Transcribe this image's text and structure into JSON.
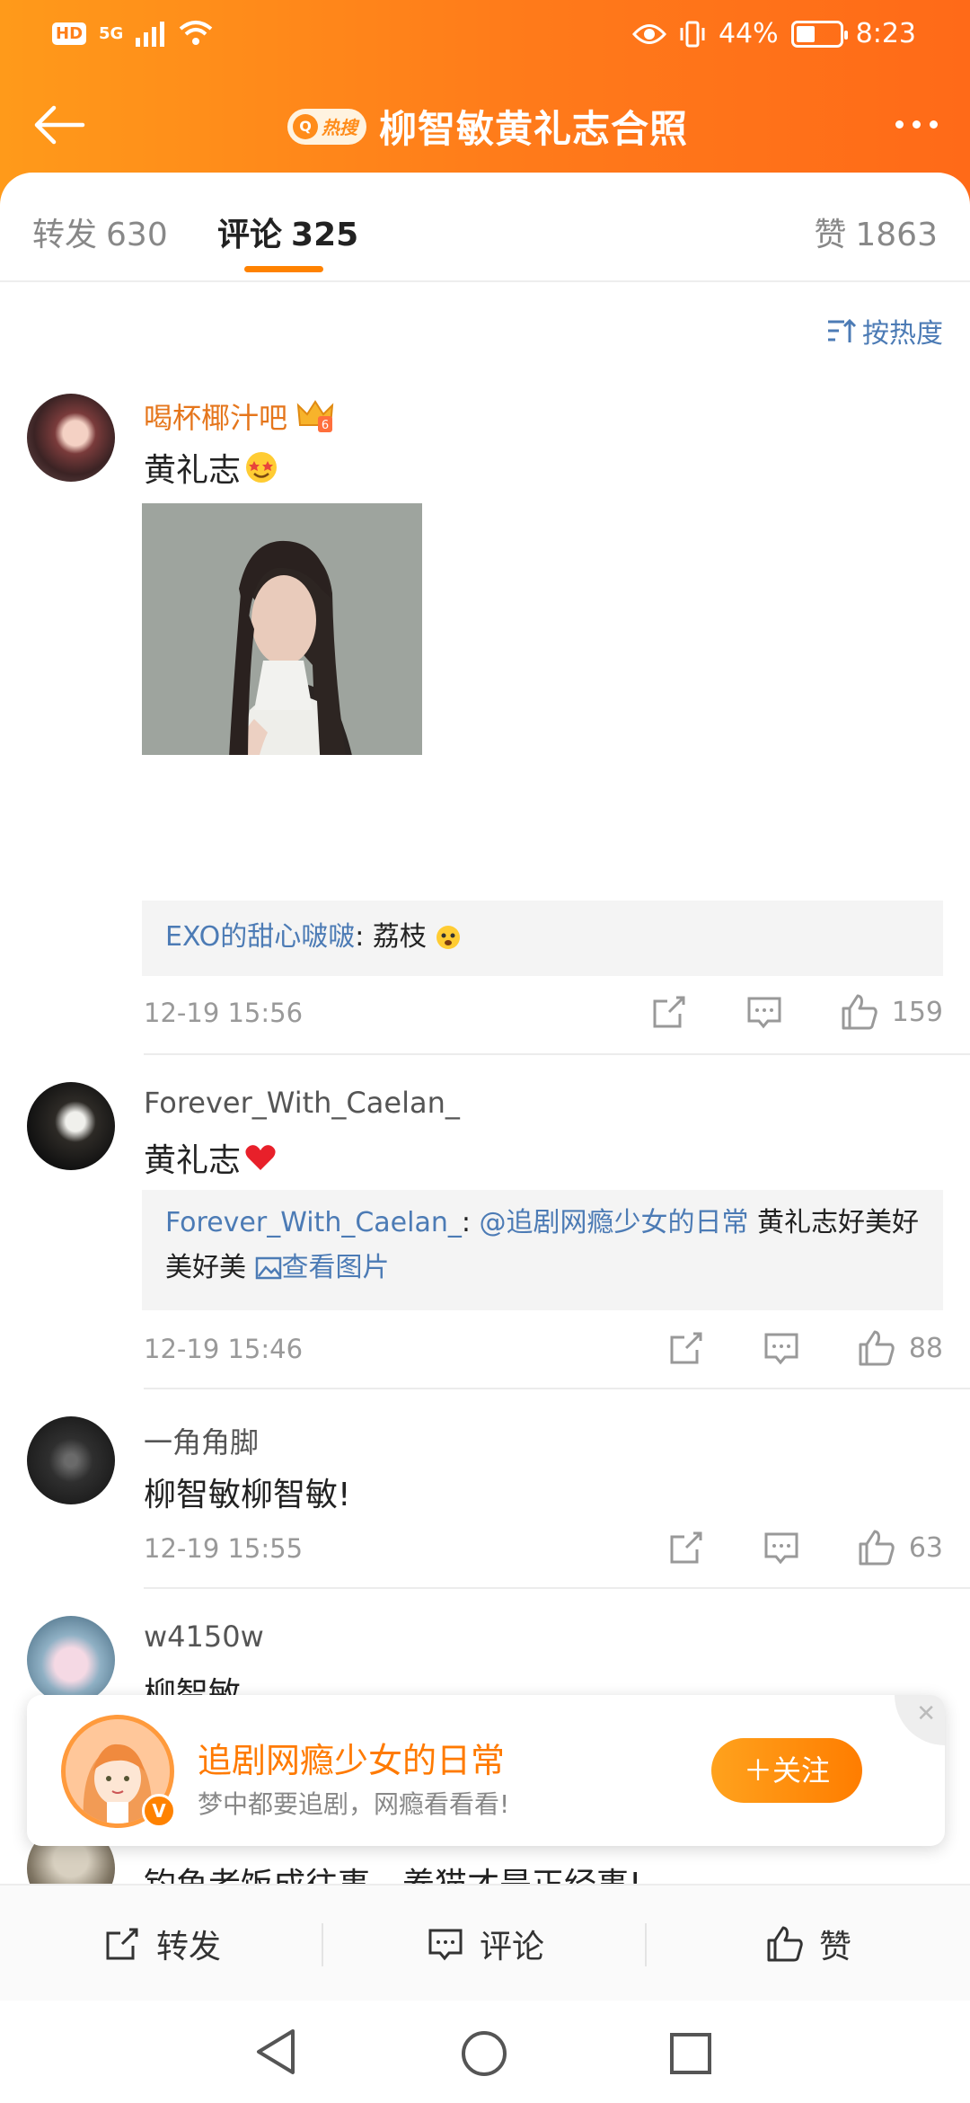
{
  "status": {
    "network": "5G",
    "hd": "HD",
    "battery": "44%",
    "battery_level": 0.44,
    "time": "8:23"
  },
  "header": {
    "hot_badge": "热搜",
    "title": "柳智敏黄礼志合照"
  },
  "tabs": [
    {
      "label": "转发",
      "count": "630"
    },
    {
      "label": "评论",
      "count": "325"
    },
    {
      "label": "赞",
      "count": "1863"
    }
  ],
  "sort_label": "按热度",
  "comments": [
    {
      "user": "喝杯椰汁吧",
      "level": "6",
      "text": "黄礼志",
      "reply_user": "EXO的甜心啵啵",
      "reply_text": ": 荔枝",
      "time": "12-19 15:56",
      "likes": "159"
    },
    {
      "user": "Forever_With_Caelan_",
      "text": "黄礼志",
      "reply_user": "Forever_With_Caelan_",
      "reply_sep": ": ",
      "reply_mention": "@追剧网瘾少女的日常",
      "reply_text": " 黄礼志好美好美好美 ",
      "reply_link": "查看图片",
      "time": "12-19 15:46",
      "likes": "88"
    },
    {
      "user": "一角角脚",
      "text": "柳智敏柳智敏!",
      "time": "12-19 15:55",
      "likes": "63"
    },
    {
      "user": "w4150w",
      "text": "柳智敏"
    },
    {
      "text": "钓鱼者饭成往事，养猫才是正经事!"
    }
  ],
  "follow_card": {
    "name": "追剧网瘾少女的日常",
    "desc": "梦中都要追剧，网瘾看看看!",
    "button": "＋关注",
    "verified": "V"
  },
  "toolbar": {
    "repost": "转发",
    "comment": "评论",
    "like": "赞"
  }
}
